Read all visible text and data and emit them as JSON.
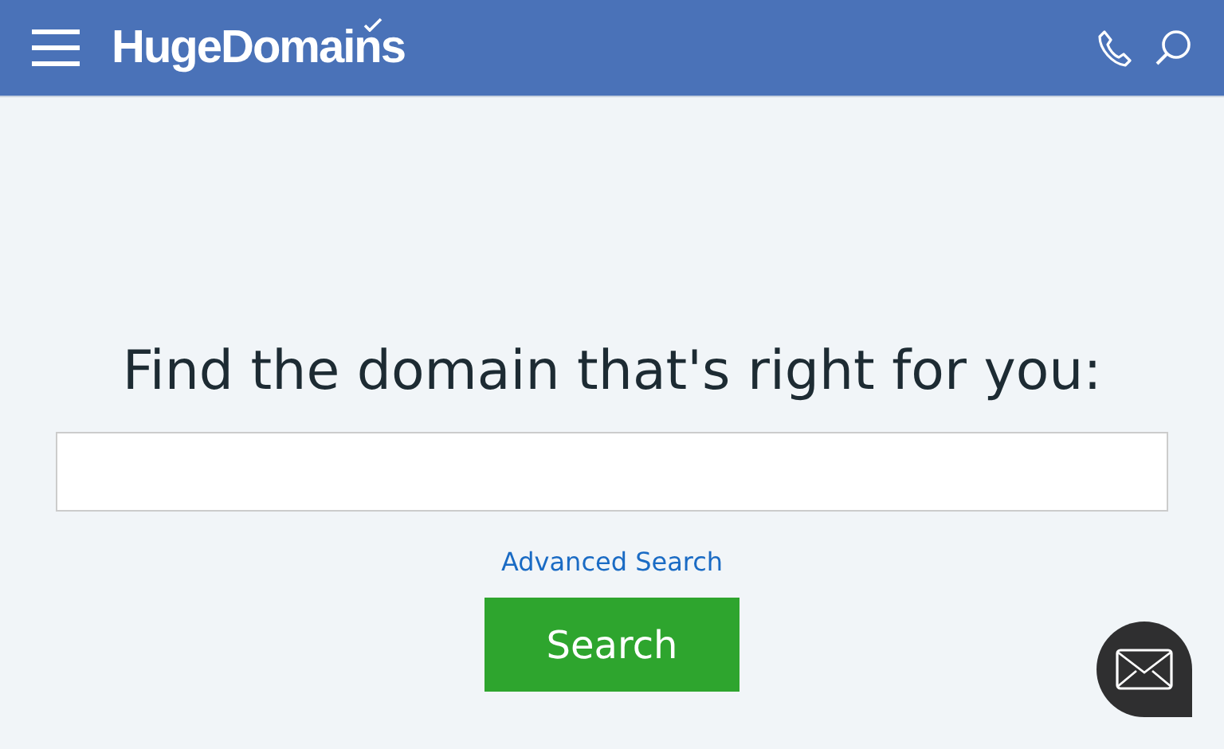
{
  "header": {
    "logo": "HugeDomains"
  },
  "search": {
    "heading": "Find the domain that's right for you:",
    "advanced_link": "Advanced Search",
    "button": "Search"
  }
}
